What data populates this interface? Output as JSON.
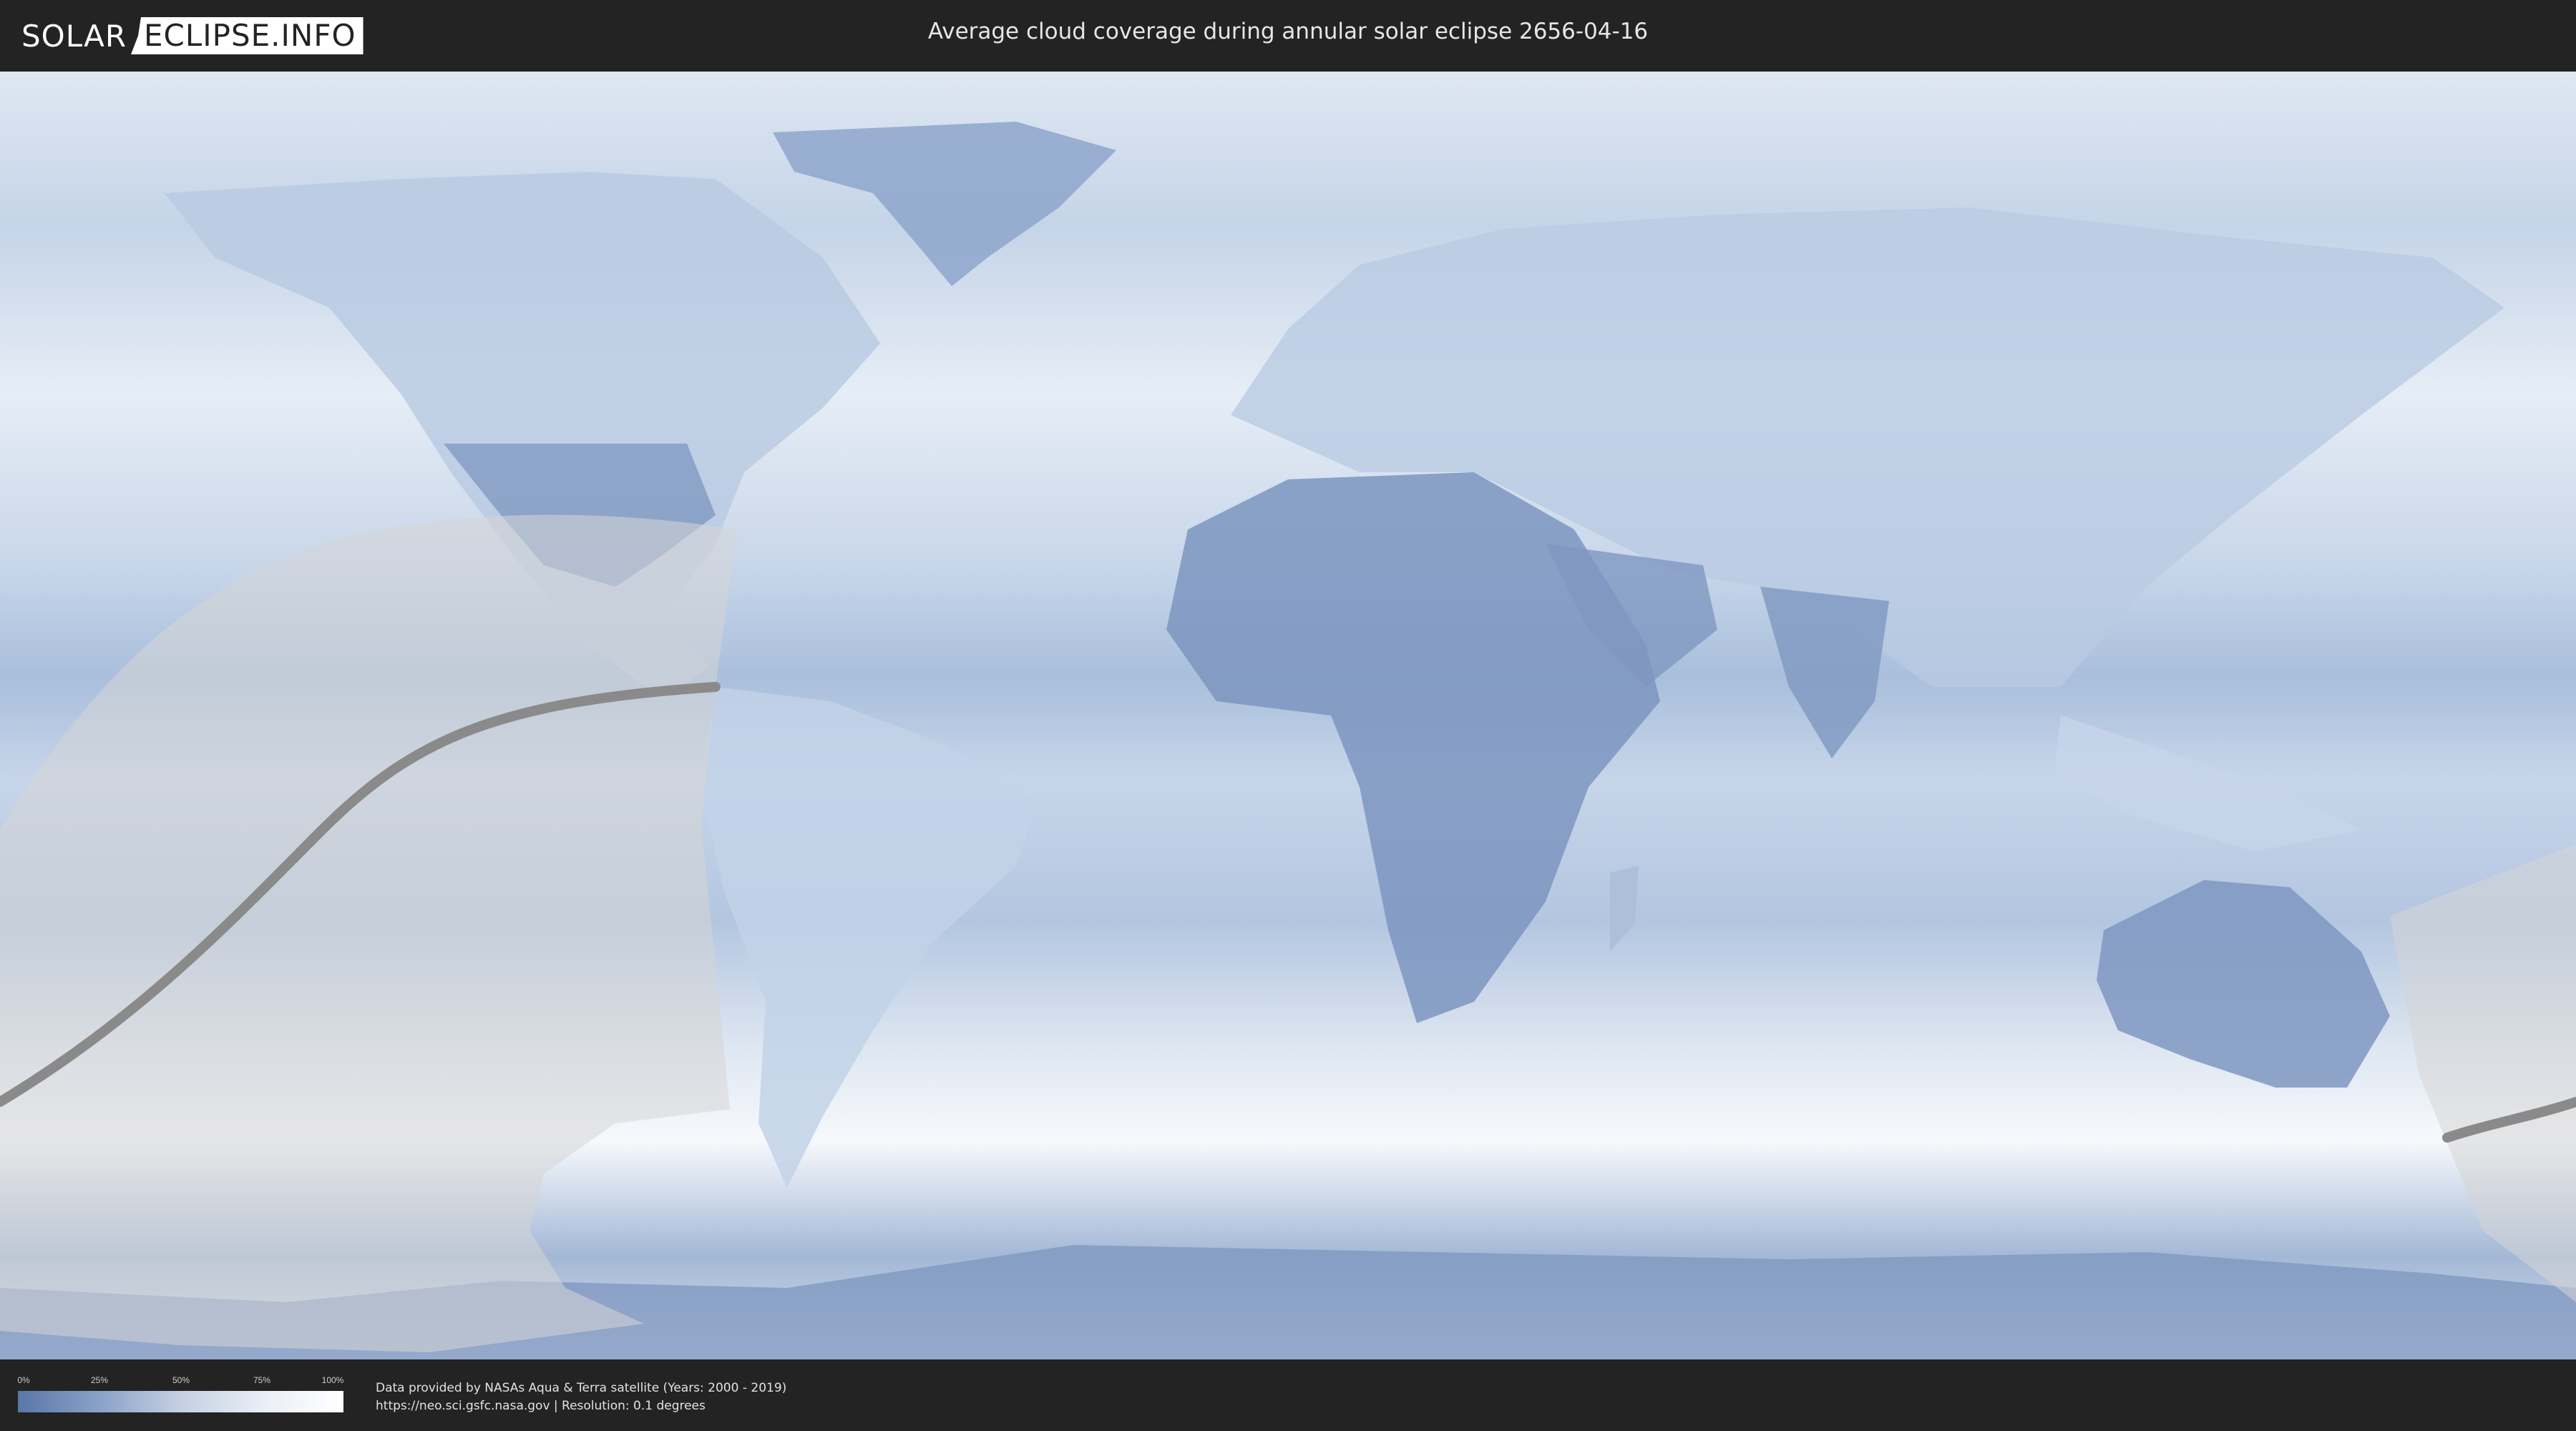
{
  "header": {
    "logo_left": "SOLAR",
    "logo_right": "ECLIPSE.INFO",
    "title": "Average cloud coverage during annular solar eclipse 2656-04-16"
  },
  "map": {
    "projection": "equirectangular world map",
    "layer": "average cloud coverage",
    "colors": {
      "clear": "#5a76a8",
      "cloudy": "#ffffff",
      "land_low_cloud": "#7f97c1",
      "eclipse_shadow_overlay": "#cfcfcf",
      "central_line": "#8a8a8a"
    },
    "overlays": [
      "eclipse-visibility-zone",
      "central-path-of-annularity"
    ]
  },
  "legend": {
    "ticks": [
      "0%",
      "25%",
      "50%",
      "75%",
      "100%"
    ],
    "colors": {
      "start": "#5a76a8",
      "end": "#ffffff"
    }
  },
  "footer": {
    "credit_line1": "Data provided by NASAs Aqua & Terra satellite (Years: 2000 - 2019)",
    "credit_line2": "https://neo.sci.gsfc.nasa.gov | Resolution: 0.1 degrees"
  }
}
